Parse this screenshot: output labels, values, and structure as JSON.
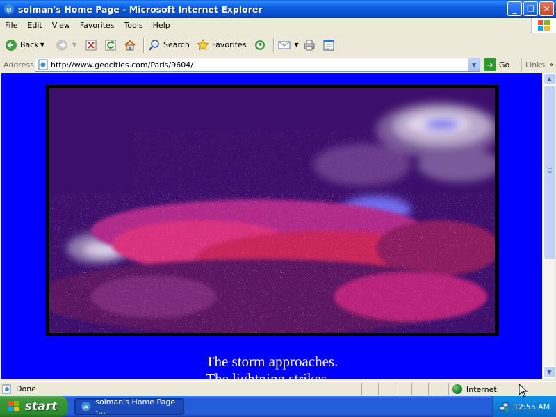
{
  "window": {
    "title": "solman's Home Page - Microsoft Internet Explorer",
    "controls": {
      "minimize": "_",
      "restore": "❐",
      "close": "✕"
    }
  },
  "menu": {
    "items": [
      "File",
      "Edit",
      "View",
      "Favorites",
      "Tools",
      "Help"
    ]
  },
  "toolbar": {
    "back_label": "Back",
    "search_label": "Search",
    "favorites_label": "Favorites",
    "icons": [
      "back-arrow-icon",
      "forward-arrow-icon",
      "stop-icon",
      "refresh-icon",
      "home-icon",
      "search-icon",
      "favorites-star-icon",
      "history-icon",
      "mail-icon",
      "print-icon",
      "edit-icon"
    ]
  },
  "address": {
    "label": "Address",
    "url": "http://www.geocities.com/Paris/9604/",
    "go_label": "Go",
    "links_label": "Links"
  },
  "page": {
    "background": "#0000FF",
    "caption_1": "The storm approaches.",
    "caption_2": "The lightning strikes..."
  },
  "status": {
    "text": "Done",
    "zone": "Internet"
  },
  "taskbar": {
    "start_label": "start",
    "task_label": "solman's Home Page -...",
    "clock": "12:55 AM"
  }
}
